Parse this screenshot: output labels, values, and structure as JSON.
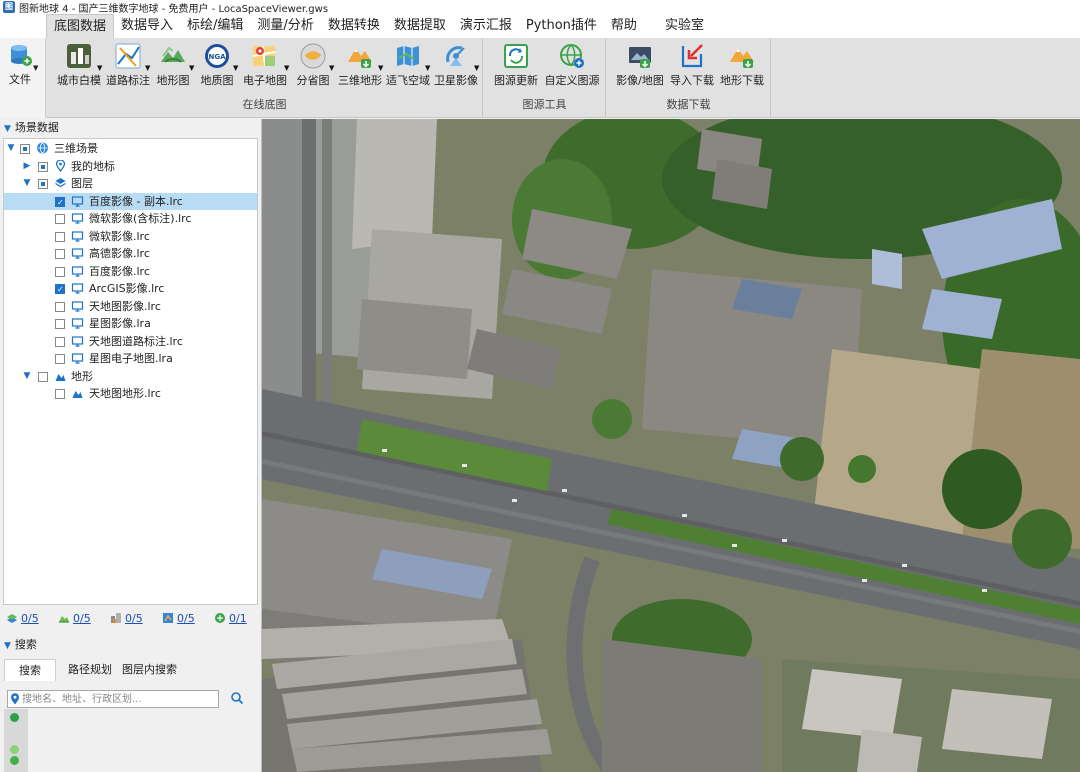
{
  "window": {
    "title": "图新地球 4 - 国产三维数字地球 - 免费用户 - LocaSpaceViewer.gws",
    "app_icon": "app-logo-icon"
  },
  "menu": {
    "tabs": [
      {
        "label": "底图数据",
        "active": true
      },
      {
        "label": "数据导入"
      },
      {
        "label": "标绘/编辑"
      },
      {
        "label": "测量/分析"
      },
      {
        "label": "数据转换"
      },
      {
        "label": "数据提取"
      },
      {
        "label": "演示汇报"
      },
      {
        "label": "Python插件"
      },
      {
        "label": "帮助"
      },
      {
        "label": "实验室"
      }
    ]
  },
  "ribbon": {
    "file": {
      "label": "文件",
      "icon": "file-db-icon"
    },
    "groups": [
      {
        "title": "在线底图",
        "buttons": [
          {
            "label": "城市白模",
            "icon": "city-model-icon",
            "dropdown": true
          },
          {
            "label": "道路标注",
            "icon": "road-label-icon",
            "dropdown": true
          },
          {
            "label": "地形图",
            "icon": "terrain-map-icon",
            "dropdown": true
          },
          {
            "label": "地质图",
            "icon": "geology-map-icon",
            "dropdown": true
          },
          {
            "label": "电子地图",
            "icon": "electronic-map-icon",
            "dropdown": true
          },
          {
            "label": "分省图",
            "icon": "province-map-icon",
            "dropdown": true
          },
          {
            "label": "三维地形",
            "icon": "3d-terrain-icon",
            "dropdown": true
          },
          {
            "label": "适飞空域",
            "icon": "airspace-icon",
            "dropdown": true
          },
          {
            "label": "卫星影像",
            "icon": "satellite-icon",
            "dropdown": true
          }
        ]
      },
      {
        "title": "图源工具",
        "buttons": [
          {
            "label": "图源更新",
            "icon": "source-update-icon"
          },
          {
            "label": "自定义图源",
            "icon": "custom-source-icon"
          }
        ]
      },
      {
        "title": "数据下载",
        "buttons": [
          {
            "label": "影像/地图",
            "icon": "image-download-icon"
          },
          {
            "label": "导入下载",
            "icon": "import-download-icon"
          },
          {
            "label": "地形下载",
            "icon": "terrain-download-icon"
          }
        ]
      }
    ]
  },
  "scene_panel": {
    "title": "场景数据",
    "tree": [
      {
        "label": "三维场景",
        "level": 0,
        "expanded": true,
        "check": "partial",
        "icon": "globe-icon"
      },
      {
        "label": "我的地标",
        "level": 1,
        "expanded": false,
        "check": "partial",
        "icon": "pin-icon"
      },
      {
        "label": "图层",
        "level": 1,
        "expanded": true,
        "check": "partial",
        "icon": "layers-icon"
      },
      {
        "label": "百度影像 - 副本.lrc",
        "level": 2,
        "check": "checked",
        "icon": "monitor-icon",
        "selected": true
      },
      {
        "label": "微软影像(含标注).lrc",
        "level": 2,
        "check": "none",
        "icon": "monitor-icon"
      },
      {
        "label": "微软影像.lrc",
        "level": 2,
        "check": "none",
        "icon": "monitor-icon"
      },
      {
        "label": "高德影像.lrc",
        "level": 2,
        "check": "none",
        "icon": "monitor-icon"
      },
      {
        "label": "百度影像.lrc",
        "level": 2,
        "check": "none",
        "icon": "monitor-icon"
      },
      {
        "label": "ArcGIS影像.lrc",
        "level": 2,
        "check": "checked",
        "icon": "monitor-icon"
      },
      {
        "label": "天地图影像.lrc",
        "level": 2,
        "check": "none",
        "icon": "monitor-icon"
      },
      {
        "label": "星图影像.lra",
        "level": 2,
        "check": "none",
        "icon": "monitor-icon"
      },
      {
        "label": "天地图道路标注.lrc",
        "level": 2,
        "check": "none",
        "icon": "monitor-icon"
      },
      {
        "label": "星图电子地图.lra",
        "level": 2,
        "check": "none",
        "icon": "monitor-icon"
      },
      {
        "label": "地形",
        "level": 1,
        "expanded": true,
        "check": "none",
        "icon": "terrain-icon"
      },
      {
        "label": "天地图地形.lrc",
        "level": 2,
        "check": "none",
        "icon": "terrain-icon"
      }
    ],
    "stats": [
      {
        "value": "0/5",
        "icon": "image-layer-icon"
      },
      {
        "value": "0/5",
        "icon": "terrain-layer-icon"
      },
      {
        "value": "0/5",
        "icon": "model-layer-icon"
      },
      {
        "value": "0/5",
        "icon": "vector-layer-icon"
      },
      {
        "value": "0/1",
        "icon": "online-layer-icon"
      }
    ]
  },
  "search_panel": {
    "title": "搜索",
    "tabs": [
      {
        "label": "搜索",
        "active": true
      },
      {
        "label": "路径规划"
      },
      {
        "label": "图层内搜索"
      }
    ],
    "placeholder": "搜地名、地址、行政区划..."
  },
  "colors": {
    "accent": "#1e73c8",
    "selection": "#b9dcf5",
    "ribbon": "#e1e1e1",
    "link": "#1d4fb0"
  }
}
